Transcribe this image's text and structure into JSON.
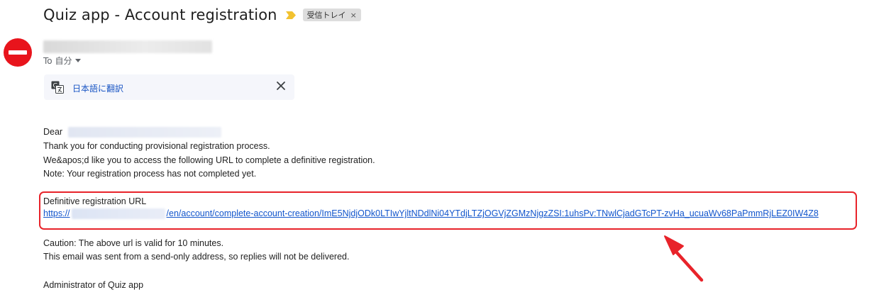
{
  "email": {
    "subject": "Quiz app - Account registration",
    "label_chip": "受信トレイ",
    "label_chip_remove": "×",
    "recipient": "To 自分",
    "translate_link": "日本語に翻訳",
    "greeting": "Dear",
    "lines": [
      "Thank you for conducting provisional registration process.",
      "We&apos;d like you to access the following URL to complete a definitive registration.",
      "Note: Your registration process has not completed yet."
    ],
    "url_heading": "Definitive registration URL",
    "url_prefix": "https://",
    "url_path": "/en/account/complete-account-creation/ImE5NjdjODk0LTIwYjltNDdlNi04YTdjLTZjOGVjZGMzNjgzZSI:1uhsPv:TNwlCjadGTcPT-zvHa_ucuaWv68PaPmmRjLEZ0IW4Z8",
    "caution_lines": [
      "Caution: The above url is valid for 10 minutes.",
      "This email was sent from a send-only address, so replies will not be delivered."
    ],
    "signature": "Administrator of Quiz app"
  },
  "icons": {
    "importance": "importance-marker-icon",
    "avatar": "no-entry-avatar-icon",
    "translate": "translate-icon",
    "close": "close-icon",
    "caret": "chevron-down-icon"
  },
  "colors": {
    "link": "#1155cc",
    "highlight_box": "#e8232a",
    "avatar": "#e8141c",
    "importance": "#f2c230"
  }
}
